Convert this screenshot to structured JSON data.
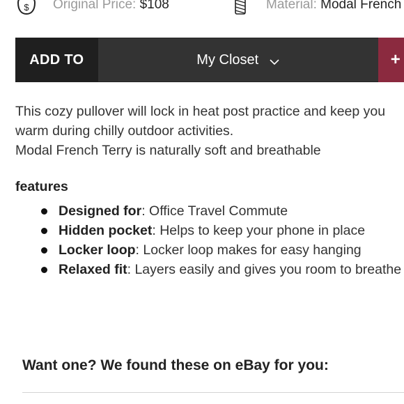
{
  "meta": {
    "price_icon": "dollar-bag-icon",
    "price_label": "Original Price:",
    "price_value": "$108",
    "material_icon": "fabric-spool-icon",
    "material_label": "Material:",
    "material_value": "Modal French T"
  },
  "action_bar": {
    "add_to_label": "ADD TO",
    "closet_value": "My Closet",
    "add_button_label": "+",
    "accent_color": "#8b2a3f"
  },
  "description": {
    "line1": "This cozy pullover will lock in heat post practice and keep you warm during chilly outdoor activities.",
    "line2": "Modal French Terry is naturally soft and breathable"
  },
  "features": {
    "heading": "features",
    "items": [
      {
        "name": "Designed for",
        "text": ": Office Travel Commute"
      },
      {
        "name": "Hidden pocket",
        "text": ": Helps to keep your phone in place"
      },
      {
        "name": "Locker loop",
        "text": ": Locker loop makes for easy hanging"
      },
      {
        "name": "Relaxed fit",
        "text": ": Layers easily and gives you room to breathe"
      }
    ]
  },
  "ebay": {
    "heading": "Want one? We found these on eBay for you:"
  }
}
